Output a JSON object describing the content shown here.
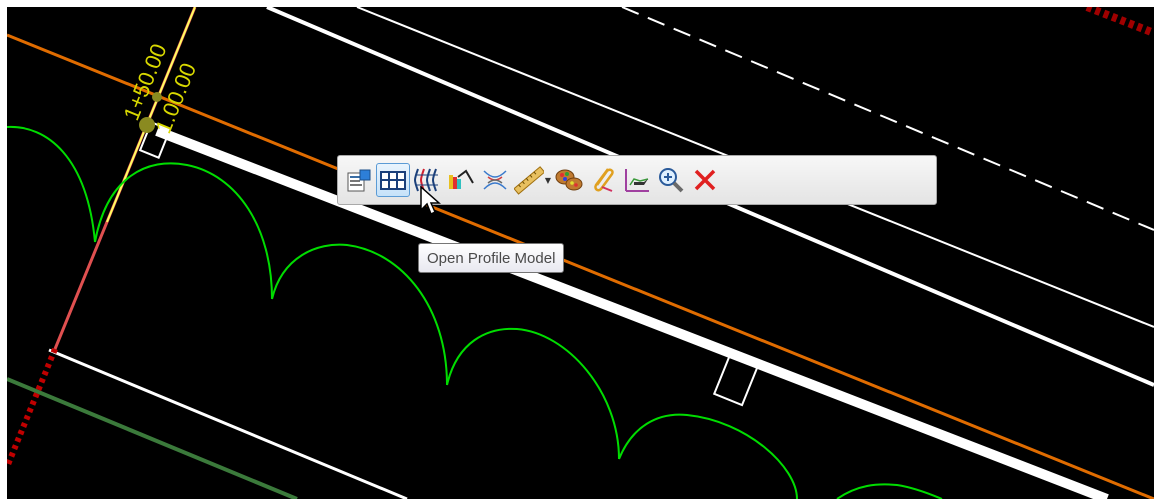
{
  "viewport": {
    "stations": [
      "1+50.00",
      "1.00.00"
    ]
  },
  "toolbar": {
    "buttons": [
      {
        "name": "properties-icon",
        "tooltip": ""
      },
      {
        "name": "open-profile-model-icon",
        "tooltip": "Open Profile Model"
      },
      {
        "name": "cross-sections-icon",
        "tooltip": ""
      },
      {
        "name": "profile-slope-icon",
        "tooltip": ""
      },
      {
        "name": "reverse-arcs-icon",
        "tooltip": ""
      },
      {
        "name": "measure-ruler-icon",
        "tooltip": ""
      },
      {
        "name": "element-palette-icon",
        "tooltip": ""
      },
      {
        "name": "attach-clip-icon",
        "tooltip": ""
      },
      {
        "name": "drive-through-icon",
        "tooltip": ""
      },
      {
        "name": "zoom-icon",
        "tooltip": ""
      },
      {
        "name": "delete-icon",
        "tooltip": ""
      }
    ]
  },
  "tooltip": {
    "text": "Open Profile Model"
  },
  "colors": {
    "canvas": "#000000",
    "green_arcs": "#00dd00",
    "orange_line": "#e06c00",
    "station_text": "#d8d800",
    "hover_highlight": "#5b9bd5"
  }
}
